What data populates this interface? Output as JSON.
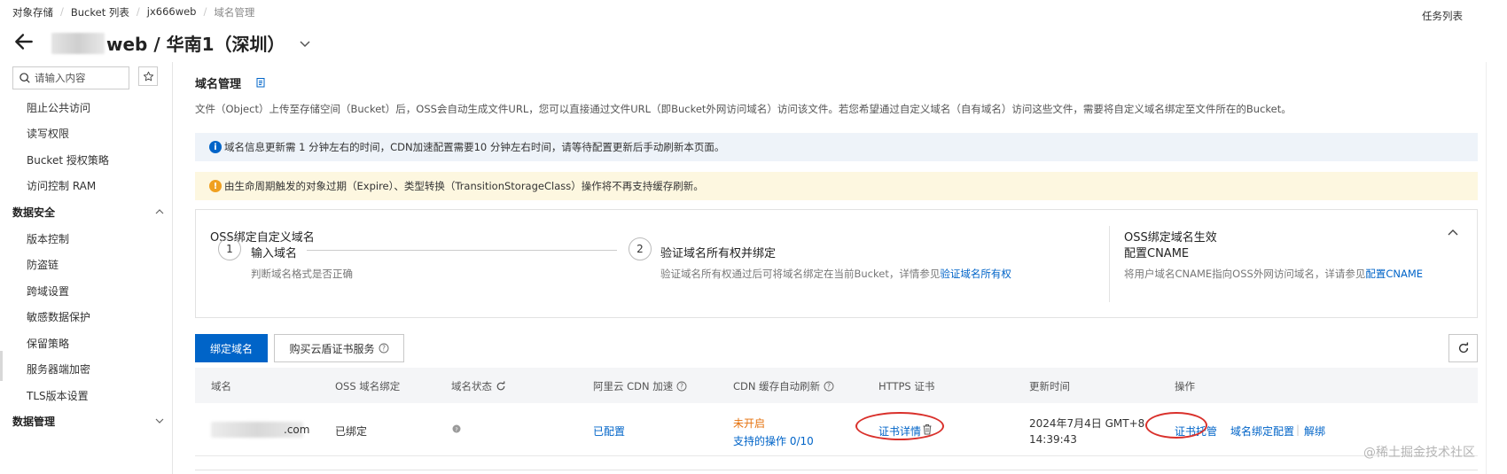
{
  "breadcrumb": {
    "items": [
      "对象存储",
      "Bucket 列表",
      "jx666web",
      "域名管理"
    ]
  },
  "header": {
    "task_list": "任务列表",
    "title": "web / 华南1（深圳）"
  },
  "sidebar": {
    "search_placeholder": "请输入内容",
    "items": [
      {
        "label": "阻止公共访问"
      },
      {
        "label": "读写权限"
      },
      {
        "label": "Bucket 授权策略"
      },
      {
        "label": "访问控制 RAM"
      }
    ],
    "group_security": "数据安全",
    "security_items": [
      {
        "label": "版本控制"
      },
      {
        "label": "防盗链"
      },
      {
        "label": "跨域设置"
      },
      {
        "label": "敏感数据保护"
      },
      {
        "label": "保留策略"
      },
      {
        "label": "服务器端加密"
      },
      {
        "label": "TLS版本设置"
      }
    ],
    "group_management": "数据管理"
  },
  "main": {
    "section_title": "域名管理",
    "description": "文件（Object）上传至存储空间（Bucket）后，OSS会自动生成文件URL，您可以直接通过文件URL（即Bucket外网访问域名）访问该文件。若您希望通过自定义域名（自有域名）访问这些文件，需要将自定义域名绑定至文件所在的Bucket。",
    "info_alert": "域名信息更新需 1 分钟左右的时间，CDN加速配置需要10 分钟左右时间，请等待配置更新后手动刷新本页面。",
    "warning_alert": "由生命周期触发的对象过期（Expire）、类型转换（TransitionStorageClass）操作将不再支持缓存刷新。",
    "steps_card": {
      "left_title": "OSS绑定自定义域名",
      "step1": {
        "num": "1",
        "title": "输入域名",
        "desc": "判断域名格式是否正确"
      },
      "step2": {
        "num": "2",
        "title": "验证域名所有权并绑定",
        "desc": "验证域名所有权通过后可将域名绑定在当前Bucket，详情参见",
        "link": "验证域名所有权"
      },
      "right_title": "OSS绑定域名生效",
      "right_subtitle": "配置CNAME",
      "right_desc": "将用户域名CNAME指向OSS外网访问域名，详请参见",
      "right_link": "配置CNAME"
    },
    "buttons": {
      "bind": "绑定域名",
      "buy_cert": "购买云盾证书服务"
    },
    "table": {
      "columns": [
        "域名",
        "OSS 域名绑定",
        "域名状态",
        "阿里云 CDN 加速",
        "CDN 缓存自动刷新",
        "HTTPS 证书",
        "更新时间",
        "操作"
      ],
      "rows": [
        {
          "domain_suffix": ".com",
          "oss_binding": "已绑定",
          "cdn": "已配置",
          "cache_status": "未开启",
          "cache_ops": "支持的操作 0/10",
          "https_cert": "证书详情",
          "updated_date": "2024年7月4日 GMT+8",
          "updated_time": "14:39:43",
          "actions": [
            "证书托管",
            "域名绑定配置",
            "解绑"
          ]
        }
      ]
    }
  },
  "watermark": "@稀土掘金技术社区",
  "colors": {
    "primary": "#0064c8",
    "warning": "#e5730f",
    "annotation": "#d9302b",
    "info_bg": "#eef3f9",
    "warning_bg": "#fdf7e0"
  }
}
